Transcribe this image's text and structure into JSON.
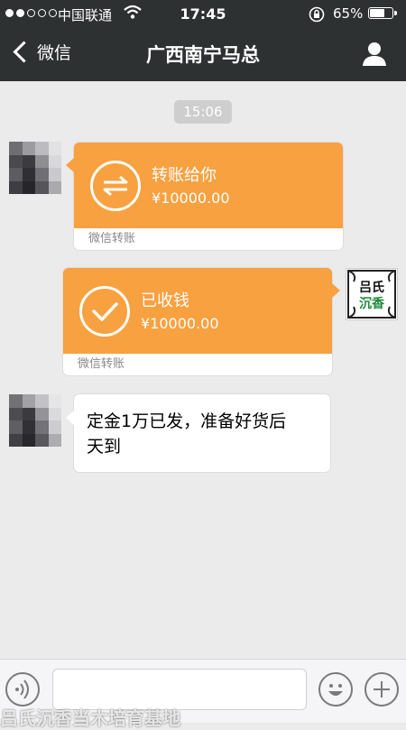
{
  "status_bar": {
    "carrier": "中国联通",
    "time": "17:45",
    "battery": "65%",
    "battery_level": 0.65,
    "signal_bars": 2,
    "signal_total": 5
  },
  "nav": {
    "back_label": "微信",
    "title": "广西南宁马总"
  },
  "chat": {
    "timestamp": "15:06",
    "messages": [
      {
        "side": "left",
        "type": "transfer",
        "title": "转账给你",
        "amount": "¥10000.00",
        "footer": "微信转账",
        "icon": "transfer-arrows-icon"
      },
      {
        "side": "right",
        "type": "transfer",
        "title": "已收钱",
        "amount": "¥10000.00",
        "footer": "微信转账",
        "icon": "checkmark-icon"
      },
      {
        "side": "left",
        "type": "text",
        "text_line1": "定金1万已发，准备好货后",
        "text_line2": "天到"
      }
    ]
  },
  "avatars": {
    "right_logo_line1": "吕氏",
    "right_logo_line2": "沉香"
  },
  "input_bar": {
    "voice_icon": "voice-icon",
    "emoji_icon": "emoji-icon",
    "plus_icon": "plus-icon"
  },
  "watermark": "吕氏沉香当木培育基地",
  "colors": {
    "nav_bg": "#2e3132",
    "chat_bg": "#ebebeb",
    "transfer_orange": "#f7a140"
  }
}
